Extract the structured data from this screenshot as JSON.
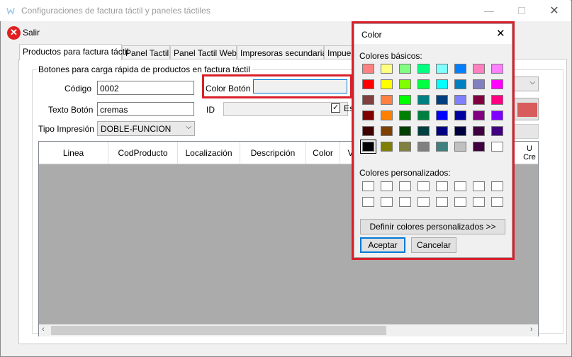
{
  "window": {
    "title": "Configuraciones de factura táctil y paneles táctiles"
  },
  "toolbar": {
    "exit_label": "Salir"
  },
  "tabs": [
    {
      "label": "Productos para factura táctil"
    },
    {
      "label": "Panel Tactil"
    },
    {
      "label": "Panel Tactil Web"
    },
    {
      "label": "Impresoras secundarias"
    },
    {
      "label": "Impues"
    }
  ],
  "group": {
    "title": "Botones para carga rápida de productos  en factura táctil"
  },
  "form": {
    "codigo_label": "Código",
    "codigo_value": "0002",
    "texto_label": "Texto Botón",
    "texto_value": "cremas",
    "tipo_label": "Tipo Impresión",
    "tipo_value": "DOBLE-FUNCION",
    "color_label": "Color Botón",
    "color_value": "",
    "id_label": "ID",
    "id_value": "",
    "checkbox_label": "Es",
    "preview_color": "#d85c5c"
  },
  "grid": {
    "columns": [
      "Linea",
      "CodProducto",
      "Localización",
      "Descripción",
      "Color",
      "V"
    ],
    "cut_header": "U\nCre"
  },
  "color_dialog": {
    "title": "Color",
    "basic_label": "Colores básicos:",
    "custom_label": "Colores personalizados:",
    "define_button": "Definir colores personalizados >>",
    "ok_button": "Aceptar",
    "cancel_button": "Cancelar",
    "basic_colors": [
      [
        "#ff8080",
        "#ffff80",
        "#80ff80",
        "#00ff80",
        "#80ffff",
        "#0080ff",
        "#ff80c0",
        "#ff80ff"
      ],
      [
        "#ff0000",
        "#ffff00",
        "#80ff00",
        "#00ff40",
        "#00ffff",
        "#0080c0",
        "#8080c0",
        "#ff00ff"
      ],
      [
        "#804040",
        "#ff8040",
        "#00ff00",
        "#008080",
        "#004080",
        "#8080ff",
        "#800040",
        "#ff0080"
      ],
      [
        "#800000",
        "#ff8000",
        "#008000",
        "#008040",
        "#0000ff",
        "#0000a0",
        "#800080",
        "#8000ff"
      ],
      [
        "#400000",
        "#804000",
        "#004000",
        "#004040",
        "#000080",
        "#000040",
        "#400040",
        "#400080"
      ],
      [
        "#000000",
        "#808000",
        "#808040",
        "#808080",
        "#408080",
        "#c0c0c0",
        "#400040",
        "#ffffff"
      ]
    ],
    "selected_index": [
      5,
      0
    ]
  }
}
